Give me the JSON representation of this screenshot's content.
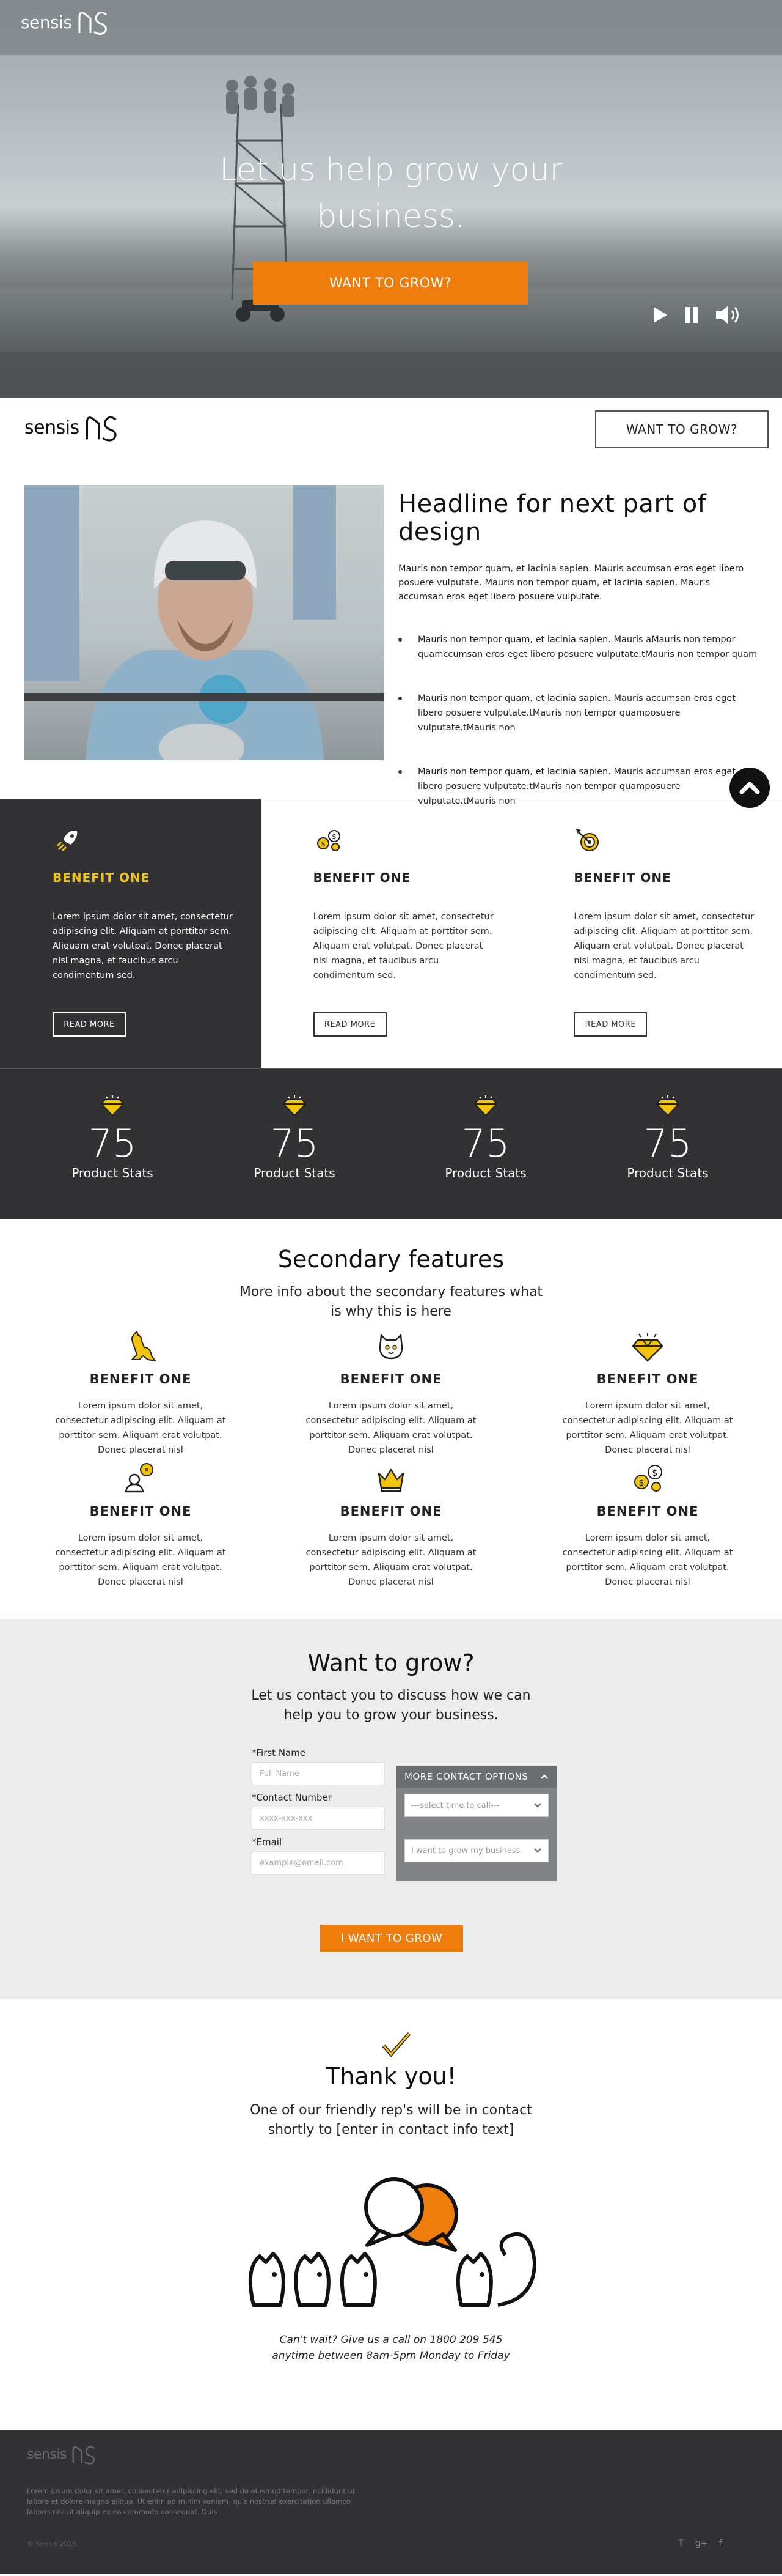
{
  "brand": {
    "name": "sensis"
  },
  "hero": {
    "title": "Let us help grow your business.",
    "cta_label": "WANT TO GROW?"
  },
  "nav": {
    "cta_label": "WANT TO GROW?"
  },
  "intro": {
    "headline": "Headline for next part of design",
    "lead": "Mauris non tempor quam, et lacinia sapien. Mauris accumsan eros eget libero posuere vulputate. Mauris non tempor quam, et lacinia sapien. Mauris accumsan eros eget libero posuere vulputate.",
    "bullets": [
      "Mauris non tempor quam, et lacinia sapien. Mauris aMauris non tempor quamccumsan eros eget libero posuere vulputate.tMauris non tempor quam",
      "Mauris non tempor quam, et lacinia sapien. Mauris accumsan eros eget libero posuere vulputate.tMauris non tempor quamposuere vulputate.tMauris non",
      "Mauris non tempor quam, et lacinia sapien. Mauris accumsan eros eget libero posuere vulputate.tMauris non tempor quamposuere vulputate.tMauris non"
    ]
  },
  "benefits": [
    {
      "icon": "rocket-icon",
      "title": "BENEFIT ONE",
      "text": "Lorem ipsum dolor sit amet, consectetur adipiscing elit. Aliquam at porttitor sem. Aliquam erat volutpat. Donec placerat nisl magna, et faucibus arcu condimentum sed.",
      "button": "READ MORE"
    },
    {
      "icon": "coins-icon",
      "title": "BENEFIT ONE",
      "text": "Lorem ipsum dolor sit amet, consectetur adipiscing elit. Aliquam at porttitor sem. Aliquam erat volutpat. Donec placerat nisl magna, et faucibus arcu condimentum sed.",
      "button": "READ MORE"
    },
    {
      "icon": "target-icon",
      "title": "BENEFIT ONE",
      "text": "Lorem ipsum dolor sit amet, consectetur adipiscing elit. Aliquam at porttitor sem. Aliquam erat volutpat. Donec placerat nisl magna, et faucibus arcu condimentum sed.",
      "button": "READ MORE"
    }
  ],
  "stats": [
    {
      "icon": "diamond-icon",
      "value": "75",
      "label": "Product Stats"
    },
    {
      "icon": "diamond-icon",
      "value": "75",
      "label": "Product Stats"
    },
    {
      "icon": "diamond-icon",
      "value": "75",
      "label": "Product Stats"
    },
    {
      "icon": "diamond-icon",
      "value": "75",
      "label": "Product Stats"
    }
  ],
  "secondary": {
    "title": "Secondary features",
    "subtitle": "More info about the secondary features what is why this is here",
    "features": [
      {
        "icon": "kangaroo-icon",
        "title": "BENEFIT ONE",
        "text": "Lorem ipsum dolor sit amet, consectetur adipiscing elit. Aliquam at porttitor sem. Aliquam erat volutpat. Donec placerat nisl"
      },
      {
        "icon": "cat-icon",
        "title": "BENEFIT ONE",
        "text": "Lorem ipsum dolor sit amet, consectetur adipiscing elit. Aliquam at porttitor sem. Aliquam erat volutpat. Donec placerat nisl"
      },
      {
        "icon": "diamond-icon",
        "title": "BENEFIT ONE",
        "text": "Lorem ipsum dolor sit amet, consectetur adipiscing elit. Aliquam at porttitor sem. Aliquam erat volutpat. Donec placerat nisl"
      },
      {
        "icon": "person-chat-icon",
        "title": "BENEFIT ONE",
        "text": "Lorem ipsum dolor sit amet, consectetur adipiscing elit. Aliquam at porttitor sem. Aliquam erat volutpat. Donec placerat nisl"
      },
      {
        "icon": "crown-icon",
        "title": "BENEFIT ONE",
        "text": "Lorem ipsum dolor sit amet, consectetur adipiscing elit. Aliquam at porttitor sem. Aliquam erat volutpat. Donec placerat nisl"
      },
      {
        "icon": "coins-icon",
        "title": "BENEFIT ONE",
        "text": "Lorem ipsum dolor sit amet, consectetur adipiscing elit. Aliquam at porttitor sem. Aliquam erat volutpat. Donec placerat nisl"
      }
    ]
  },
  "contact": {
    "title": "Want to grow?",
    "subtitle": "Let us contact you to discuss how we can help you to grow your business.",
    "fields": [
      {
        "label": "*First Name",
        "placeholder": "Full Name",
        "value": ""
      },
      {
        "label": "*Contact Number",
        "placeholder": "xxxx-xxx-xxx",
        "value": ""
      },
      {
        "label": "*Email",
        "placeholder": "example@email.com",
        "value": ""
      }
    ],
    "options_title": "MORE CONTACT OPTIONS",
    "select_time": "---select time to call---",
    "select_reason": "I want to grow my business",
    "submit_label": "I WANT TO GROW"
  },
  "thanks": {
    "title": "Thank you!",
    "subtitle": "One of our friendly rep's will be in contact shortly to [enter in contact info text]",
    "callout": "Can't wait? Give us a call on 1800 209 545 anytime between 8am-5pm Monday to Friday"
  },
  "footer": {
    "text": "Lorem ipsum dolor sit amet, consectetur adipiscing elit, sed do eiusmod tempor incididunt ut labore et dolore magna aliqua. Ut enim ad minim veniam, quis nostrud exercitation ullamco laboris nisi ut aliquip ex ea commodo consequat. Duis",
    "copyright": "© Sensis 2015",
    "social": [
      "twitter-icon",
      "google-plus-icon",
      "facebook-icon"
    ]
  },
  "colors": {
    "accent": "#ee7d0c",
    "dark": "#323234",
    "highlight": "#f1c40f",
    "light_bg": "#ececed"
  }
}
